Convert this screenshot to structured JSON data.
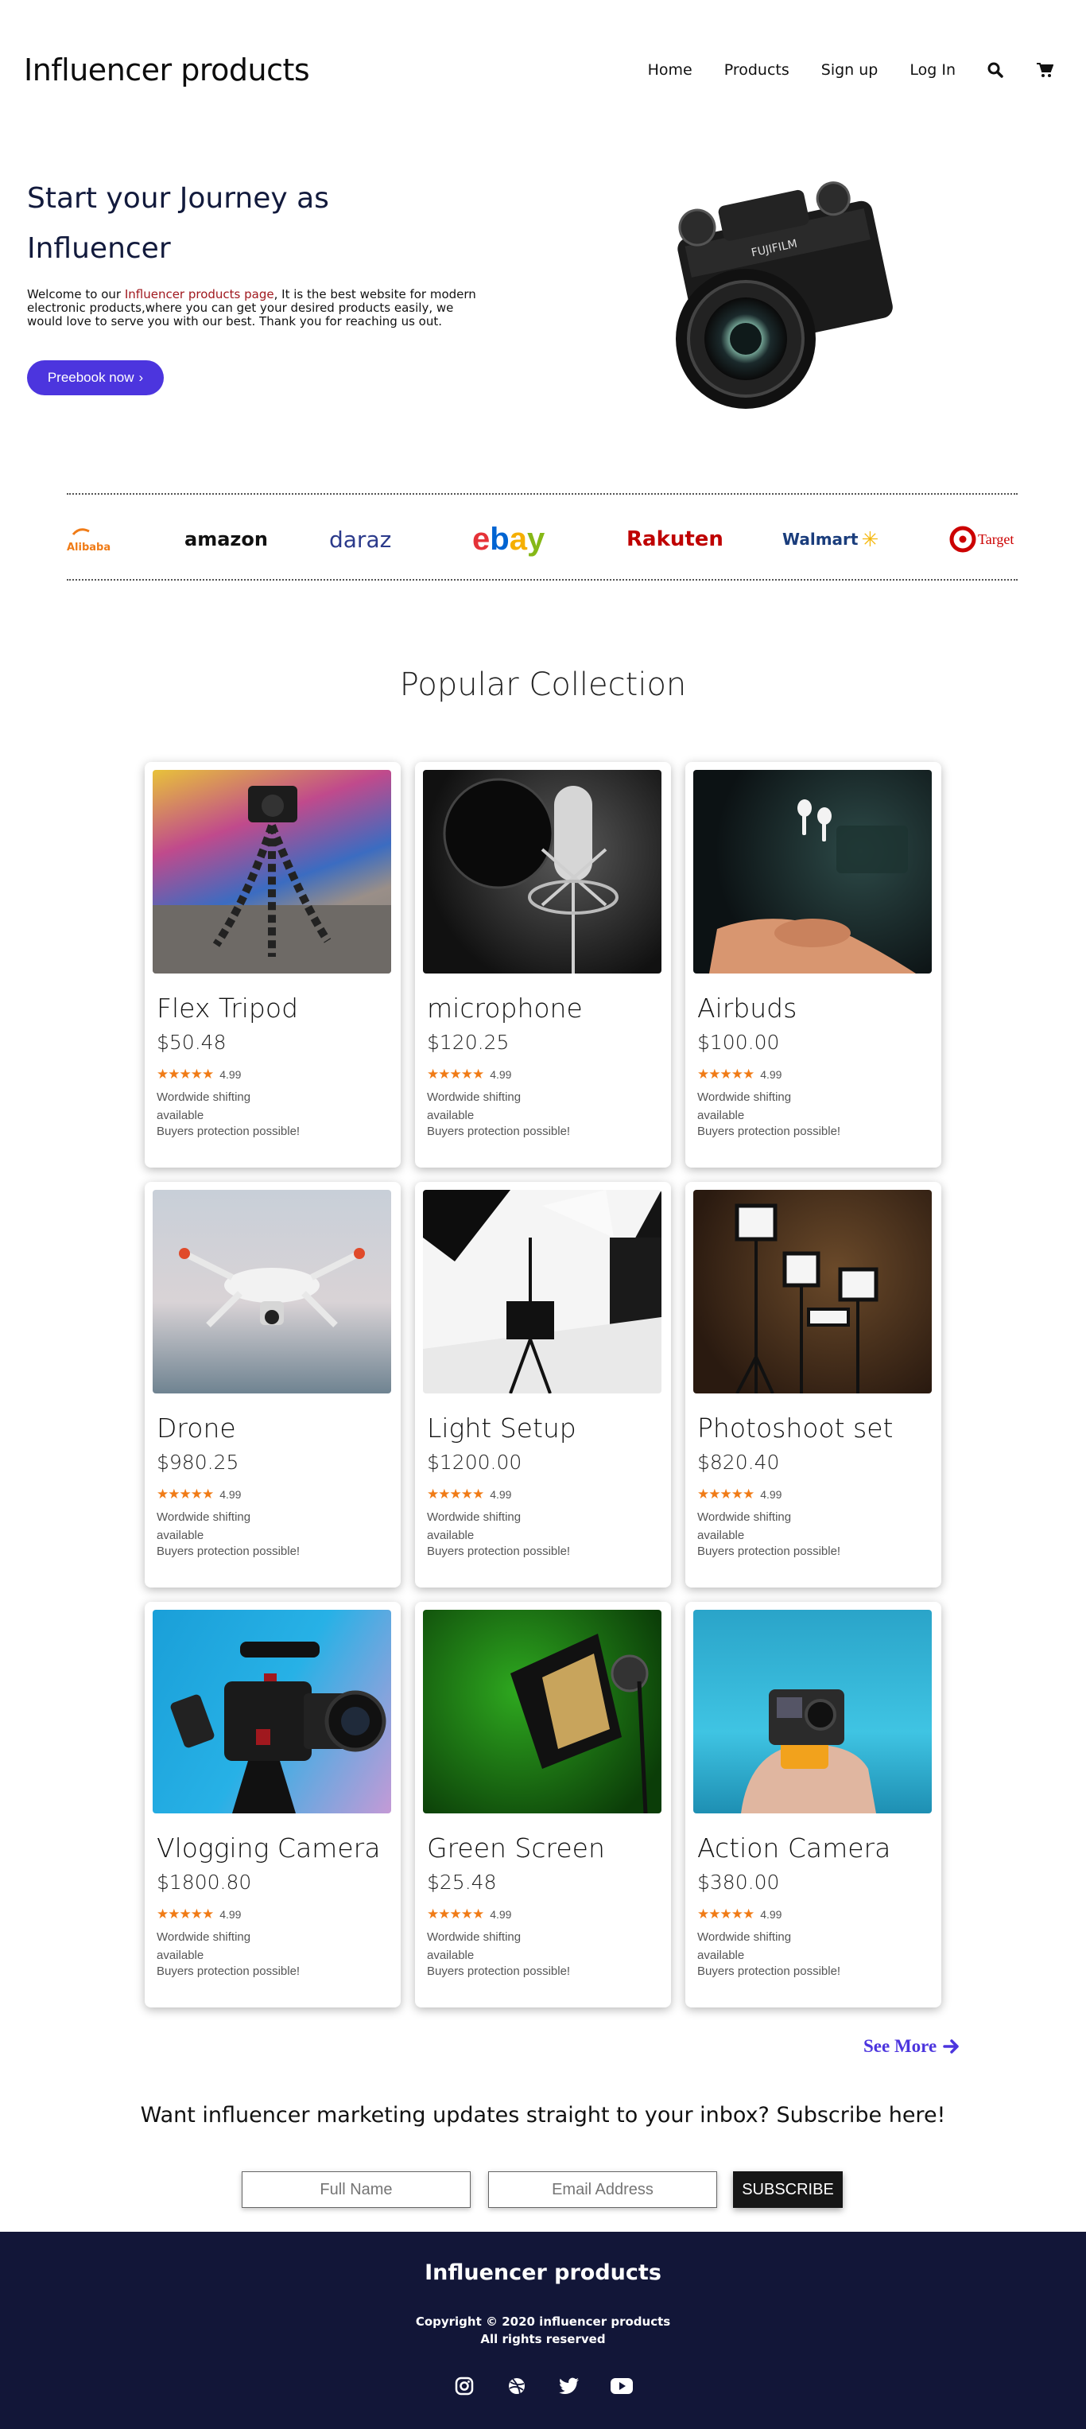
{
  "header": {
    "brand": "Influencer products",
    "nav": [
      "Home",
      "Products",
      "Sign up",
      "Log In"
    ]
  },
  "hero": {
    "title": "Start your Journey as Influencer",
    "text_before": "Welcome to our ",
    "text_highlight": "Influencer products page",
    "text_after": ", It is the best website for modern electronic products,where you can get your desired products easily, we would love to serve you with our best. Thank you for reaching us out.",
    "cta_label": "Preebook now",
    "colors": {
      "accent": "#4c35de",
      "highlight": "#a0181e"
    }
  },
  "brands": [
    "Alibaba",
    "amazon",
    "daraz",
    "ebay",
    "Rakuten",
    "Walmart",
    "Target"
  ],
  "collection": {
    "title": "Popular Collection",
    "products": [
      {
        "name": "Flex Tripod",
        "price": "$50.48",
        "rating": "4.99",
        "shipping": "Wordwide shifting available",
        "protection": "Buyers protection possible!"
      },
      {
        "name": "microphone",
        "price": "$120.25",
        "rating": "4.99",
        "shipping": "Wordwide shifting available",
        "protection": "Buyers protection possible!"
      },
      {
        "name": "Airbuds",
        "price": "$100.00",
        "rating": "4.99",
        "shipping": "Wordwide shifting available",
        "protection": "Buyers protection possible!"
      },
      {
        "name": "Drone",
        "price": "$980.25",
        "rating": "4.99",
        "shipping": "Wordwide shifting available",
        "protection": "Buyers protection possible!"
      },
      {
        "name": "Light Setup",
        "price": "$1200.00",
        "rating": "4.99",
        "shipping": "Wordwide shifting available",
        "protection": "Buyers protection possible!"
      },
      {
        "name": "Photoshoot set",
        "price": "$820.40",
        "rating": "4.99",
        "shipping": "Wordwide shifting available",
        "protection": "Buyers protection possible!"
      },
      {
        "name": "Vlogging Camera",
        "price": "$1800.80",
        "rating": "4.99",
        "shipping": "Wordwide shifting available",
        "protection": "Buyers protection possible!"
      },
      {
        "name": "Green Screen",
        "price": "$25.48",
        "rating": "4.99",
        "shipping": "Wordwide shifting available",
        "protection": "Buyers protection possible!"
      },
      {
        "name": "Action Camera",
        "price": "$380.00",
        "rating": "4.99",
        "shipping": "Wordwide shifting available",
        "protection": "Buyers protection possible!"
      }
    ],
    "see_more": "See More"
  },
  "subscribe": {
    "title": "Want influencer marketing updates straight to your inbox? Subscribe here!",
    "name_placeholder": "Full Name",
    "email_placeholder": "Email Address",
    "button": "SUBSCRIBE"
  },
  "footer": {
    "brand": "Influencer products",
    "copyright": "Copyright © 2020 influencer products",
    "rights": "All rights reserved",
    "socials": [
      "instagram-icon",
      "dribbble-icon",
      "twitter-icon",
      "youtube-icon"
    ],
    "background": "#121638"
  }
}
